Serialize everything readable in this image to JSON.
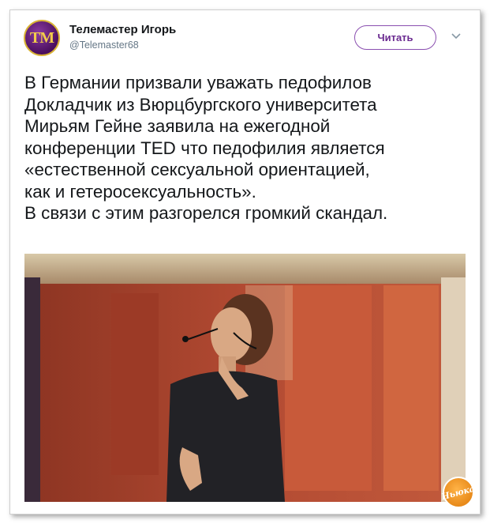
{
  "tweet": {
    "author": "Телемастер Игорь",
    "handle": "@Telemaster68",
    "avatar_text": "TM",
    "follow_label": "Читать",
    "text_lines": [
      "В Германии призвали уважать педофилов",
      "Докладчик из Вюрцбургского университета",
      "Мирьям Гейне заявила на ежегодной",
      "конференции TED что педофилия является",
      "«естественной сексуальной ориентацией,",
      "как и гетеросексуальность».",
      "В связи с этим разгорелся громкий скандал."
    ]
  },
  "watermark": {
    "text": "Ньюка"
  },
  "icons": {
    "menu": "chevron-down-icon"
  },
  "colors": {
    "accent": "#6a2a90",
    "avatar_bg": "#4a0f5e",
    "avatar_text": "#f2cc4a"
  }
}
